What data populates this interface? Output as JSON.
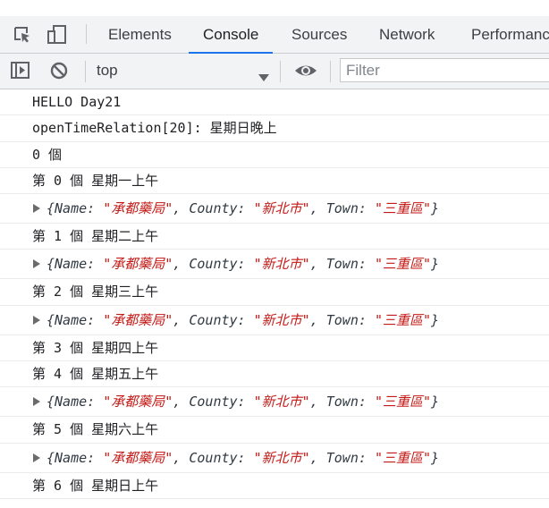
{
  "tabs": [
    {
      "label": "Elements",
      "active": false
    },
    {
      "label": "Console",
      "active": true
    },
    {
      "label": "Sources",
      "active": false
    },
    {
      "label": "Network",
      "active": false
    },
    {
      "label": "Performance",
      "active": false
    }
  ],
  "toolbar": {
    "context": "top",
    "filter_placeholder": "Filter"
  },
  "icons": {
    "inspect": "inspect-element-icon",
    "device": "device-toggle-icon",
    "sidebar": "sidebar-toggle-icon",
    "clear": "clear-console-icon",
    "caret": "dropdown-caret-icon",
    "eye": "live-expression-eye-icon",
    "expand": "expand-triangle-icon"
  },
  "colors": {
    "tab_underline": "#1a73e8",
    "string_value": "#c41a16",
    "toolbar_bg": "#f1f3f4"
  },
  "console": {
    "lines": [
      {
        "type": "text",
        "text": "HELLO Day21"
      },
      {
        "type": "text",
        "text": "openTimeRelation[20]: 星期日晚上"
      },
      {
        "type": "text",
        "text": "0 個"
      },
      {
        "type": "text",
        "text": "第 0 個 星期一上午"
      },
      {
        "type": "obj",
        "name": "承都藥局",
        "county": "新北市",
        "town": "三重區"
      },
      {
        "type": "text",
        "text": "第 1 個 星期二上午"
      },
      {
        "type": "obj",
        "name": "承都藥局",
        "county": "新北市",
        "town": "三重區"
      },
      {
        "type": "text",
        "text": "第 2 個 星期三上午"
      },
      {
        "type": "obj",
        "name": "承都藥局",
        "county": "新北市",
        "town": "三重區"
      },
      {
        "type": "text",
        "text": "第 3 個 星期四上午"
      },
      {
        "type": "text",
        "text": "第 4 個 星期五上午"
      },
      {
        "type": "obj",
        "name": "承都藥局",
        "county": "新北市",
        "town": "三重區"
      },
      {
        "type": "text",
        "text": "第 5 個 星期六上午"
      },
      {
        "type": "obj",
        "name": "承都藥局",
        "county": "新北市",
        "town": "三重區"
      },
      {
        "type": "text",
        "text": "第 6 個 星期日上午"
      }
    ]
  }
}
